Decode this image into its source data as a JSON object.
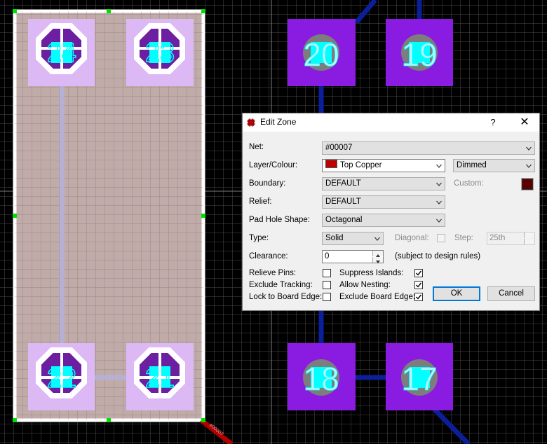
{
  "pcb": {
    "pads": [
      "24",
      "23",
      "22",
      "21",
      "20",
      "19",
      "18",
      "17"
    ],
    "zone_net_tag": "#00007"
  },
  "dialog": {
    "title": "Edit Zone",
    "help_label": "?",
    "close_label": "✕",
    "net_label": "Net:",
    "net_value": "#00007",
    "layer_label": "Layer/Colour:",
    "layer_value": "Top Copper",
    "layer_color": "#c00000",
    "display_value": "Dimmed",
    "boundary_label": "Boundary:",
    "boundary_value": "DEFAULT",
    "custom_label": "Custom:",
    "custom_color": "#5a0000",
    "relief_label": "Relief:",
    "relief_value": "DEFAULT",
    "pad_hole_label": "Pad Hole Shape:",
    "pad_hole_value": "Octagonal",
    "type_label": "Type:",
    "type_value": "Solid",
    "diagonal_label": "Diagonal:",
    "step_label": "Step:",
    "step_value": "25th",
    "clearance_label": "Clearance:",
    "clearance_value": "0",
    "clearance_note": "(subject to design rules)",
    "relieve_pins_label": "Relieve Pins:",
    "exclude_tracking_label": "Exclude Tracking:",
    "lock_board_edge_label": "Lock to Board Edge:",
    "suppress_islands_label": "Suppress Islands:",
    "allow_nesting_label": "Allow Nesting:",
    "exclude_board_edge_label": "Exclude Board Edge:",
    "ok_label": "OK",
    "cancel_label": "Cancel"
  }
}
